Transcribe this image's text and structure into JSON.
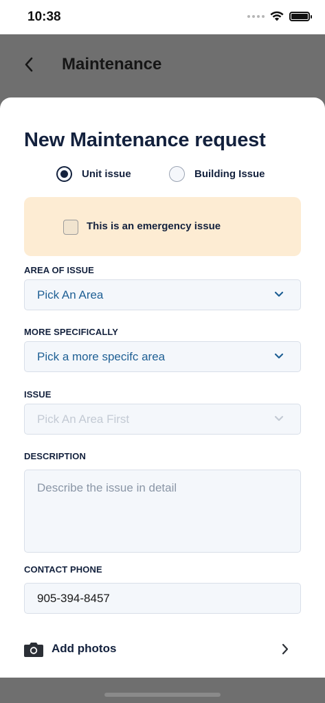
{
  "status_bar": {
    "time": "10:38",
    "icons": [
      "signal-dots-icon",
      "wifi-icon",
      "battery-icon"
    ]
  },
  "background_screen": {
    "title": "Maintenance",
    "back_icon": "chevron-left-icon"
  },
  "sheet": {
    "title": "New Maintenance request",
    "issue_type": {
      "options": [
        "Unit issue",
        "Building Issue"
      ],
      "selected": "Unit issue"
    },
    "emergency": {
      "label": "This is an emergency issue",
      "checked": false
    },
    "area": {
      "label": "AREA OF ISSUE",
      "value": "Pick An Area"
    },
    "more_specifically": {
      "label": "MORE SPECIFICALLY",
      "value": "Pick a more specifc area"
    },
    "issue": {
      "label": "ISSUE",
      "value": "Pick An Area First",
      "disabled": true
    },
    "description": {
      "label": "DESCRIPTION",
      "placeholder": "Describe the issue in detail",
      "value": ""
    },
    "contact_phone": {
      "label": "CONTACT PHONE",
      "value": "905-394-8457"
    },
    "add_photos": {
      "label": "Add photos",
      "icon": "camera-icon"
    }
  },
  "colors": {
    "navy": "#13213d",
    "link_blue": "#1e5f94",
    "emergency_bg": "#fdecd3",
    "field_bg": "#f4f7fb",
    "overlay_dim": "#6f6f6f"
  }
}
